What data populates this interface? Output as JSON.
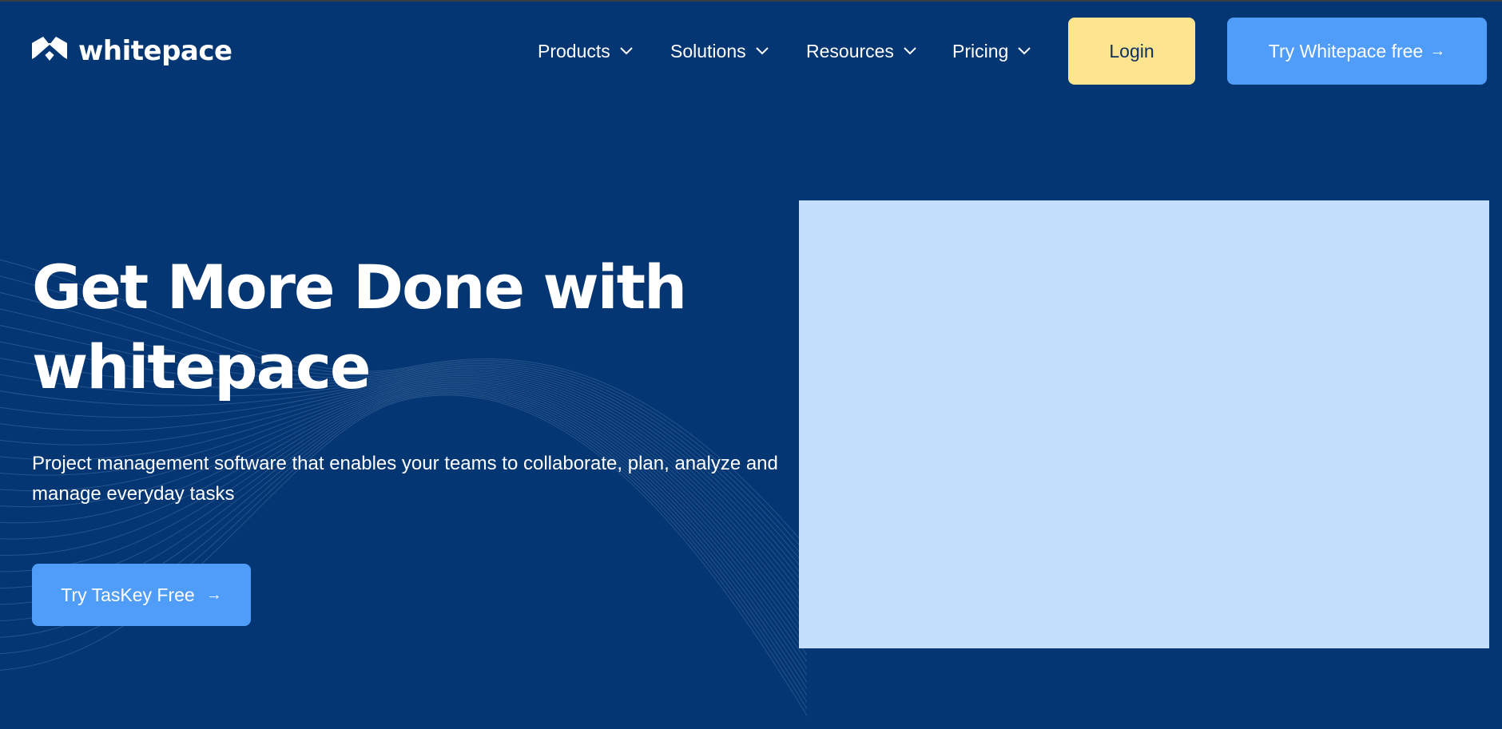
{
  "brand": {
    "name": "whitepace",
    "bg_color": "#043673",
    "accent_color": "#4f9cf9",
    "login_color": "#fde58f",
    "image_placeholder_color": "#c4dffb"
  },
  "nav": {
    "items": [
      {
        "label": "Products",
        "icon": "chevron-down-icon"
      },
      {
        "label": "Solutions",
        "icon": "chevron-down-icon"
      },
      {
        "label": "Resources",
        "icon": "chevron-down-icon"
      },
      {
        "label": "Pricing",
        "icon": "chevron-down-icon"
      }
    ],
    "login_label": "Login",
    "cta_label": "Try Whitepace free",
    "cta_icon": "arrow-right-icon"
  },
  "hero": {
    "title_line1": "Get More Done with",
    "title_line2": "whitepace",
    "subtitle_line1": "Project management software that enables your teams to collaborate, plan, analyze and",
    "subtitle_line2": "manage everyday tasks",
    "cta_label": "Try TasKey Free",
    "cta_icon": "arrow-right-icon"
  }
}
